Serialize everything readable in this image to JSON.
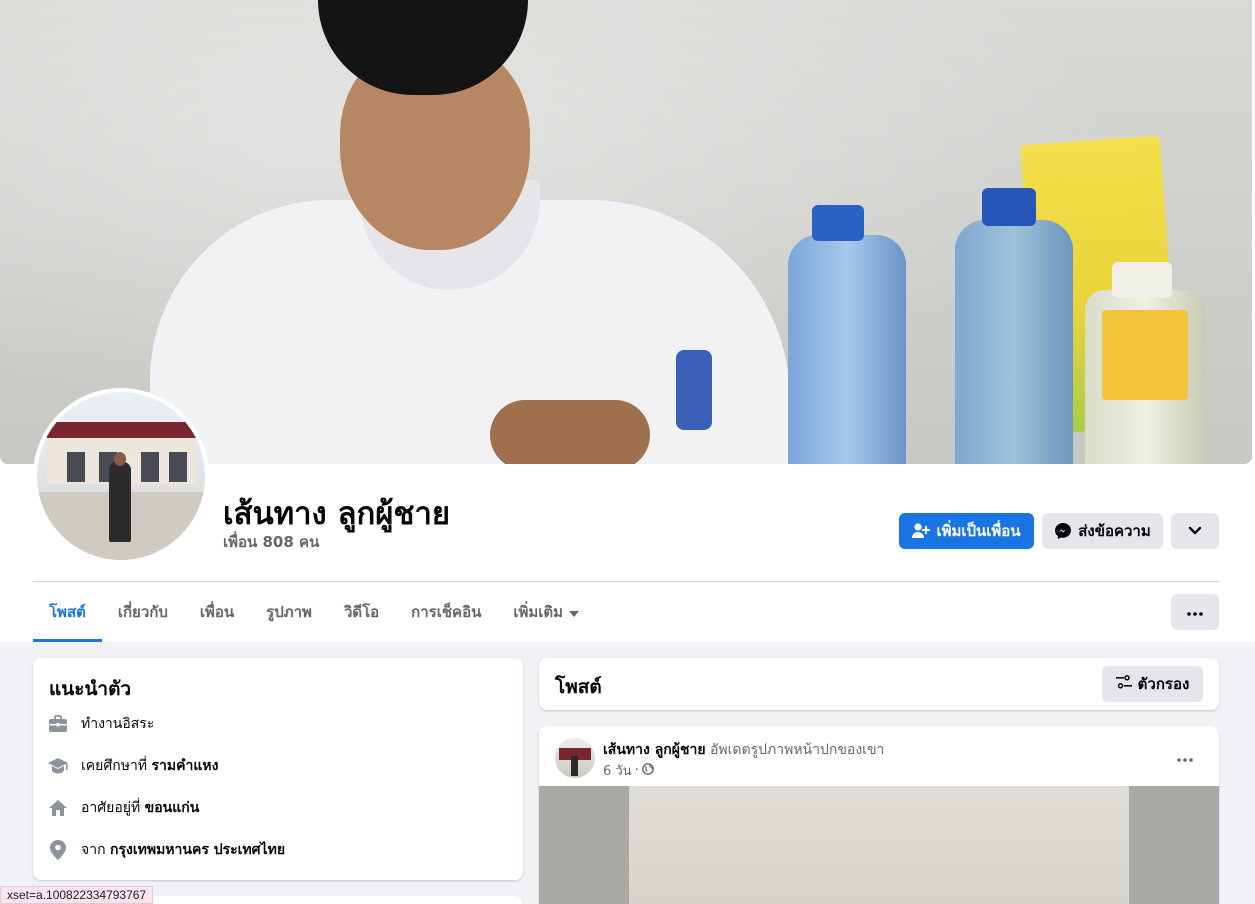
{
  "profile": {
    "name": "เส้นทาง ลูกผู้ชาย",
    "friends": "เพื่อน 808 คน"
  },
  "actions": {
    "add_friend": "เพิ่มเป็นเพื่อน",
    "message": "ส่งข้อความ"
  },
  "tabs": [
    {
      "label": "โพสต์",
      "active": true
    },
    {
      "label": "เกี่ยวกับ"
    },
    {
      "label": "เพื่อน"
    },
    {
      "label": "รูปภาพ"
    },
    {
      "label": "วิดีโอ"
    },
    {
      "label": "การเช็คอิน"
    },
    {
      "label": "เพิ่มเติม"
    }
  ],
  "intro": {
    "title": "แนะนำตัว",
    "work": "ทำงานอิสระ",
    "education_prefix": "เคยศึกษาที่",
    "education_place": "รามคำแหง",
    "lives_prefix": "อาศัยอยู่ที่",
    "lives_place": "ขอนแก่น",
    "from_prefix": "จาก",
    "from_place": "กรุงเทพมหานคร ประเทศไทย"
  },
  "posts": {
    "title": "โพสต์",
    "filter_label": "ตัวกรอง"
  },
  "post": {
    "author": "เส้นทาง ลูกผู้ชาย",
    "action": "อัพเดตรูปภาพหน้าปกของเขา",
    "time": "6 วัน"
  },
  "status_url": "xset=a.100822334793767",
  "colors": {
    "accent": "#1b74e4",
    "background": "#f0f2f5",
    "secondary_button": "#e4e6eb",
    "muted_text": "#65676b"
  }
}
